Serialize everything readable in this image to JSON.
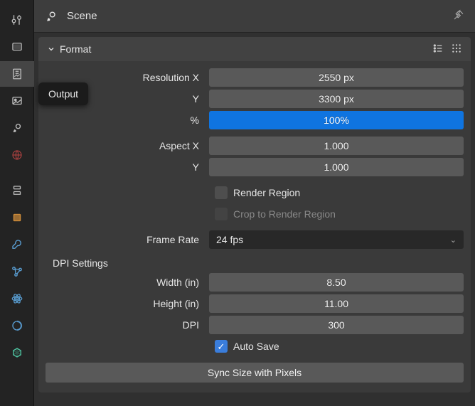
{
  "header": {
    "title": "Scene"
  },
  "tooltip": "Output",
  "section_format": {
    "title": "Format",
    "resolution_x_label": "Resolution X",
    "resolution_x_value": "2550 px",
    "resolution_y_label": "Y",
    "resolution_y_value": "3300 px",
    "percent_label": "%",
    "percent_value": "100%",
    "aspect_x_label": "Aspect X",
    "aspect_x_value": "1.000",
    "aspect_y_label": "Y",
    "aspect_y_value": "1.000",
    "render_region_label": "Render Region",
    "render_region_checked": false,
    "crop_label": "Crop to Render Region",
    "crop_checked": false,
    "frame_rate_label": "Frame Rate",
    "frame_rate_value": "24 fps"
  },
  "dpi": {
    "title": "DPI Settings",
    "width_label": "Width (in)",
    "width_value": "8.50",
    "height_label": "Height (in)",
    "height_value": "11.00",
    "dpi_label": "DPI",
    "dpi_value": "300",
    "auto_save_label": "Auto Save",
    "auto_save_checked": true,
    "sync_button": "Sync Size with Pixels"
  }
}
